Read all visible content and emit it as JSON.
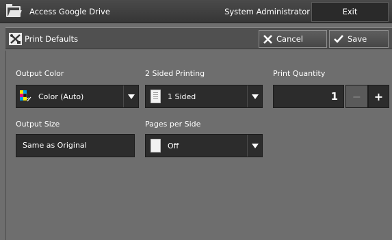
{
  "topbar": {
    "app_title": "Access Google Drive",
    "user": "System Administrator",
    "exit_label": "Exit",
    "app_icon": "folder-icon"
  },
  "subbar": {
    "title": "Print Defaults",
    "title_icon": "print-defaults-icon",
    "cancel_label": "Cancel",
    "save_label": "Save"
  },
  "settings": {
    "output_color": {
      "label": "Output Color",
      "value": "Color (Auto)"
    },
    "two_sided": {
      "label": "2 Sided Printing",
      "value": "1 Sided"
    },
    "print_quantity": {
      "label": "Print Quantity",
      "value": "1",
      "minus": "−",
      "plus": "+"
    },
    "output_size": {
      "label": "Output Size",
      "value": "Same as Original"
    },
    "pages_per_side": {
      "label": "Pages per Side",
      "value": "Off"
    }
  },
  "colors": {
    "background": "#6e6e6e",
    "topbar": "#3c3c3c",
    "field": "#2c2c2c",
    "text": "#ffffff"
  }
}
